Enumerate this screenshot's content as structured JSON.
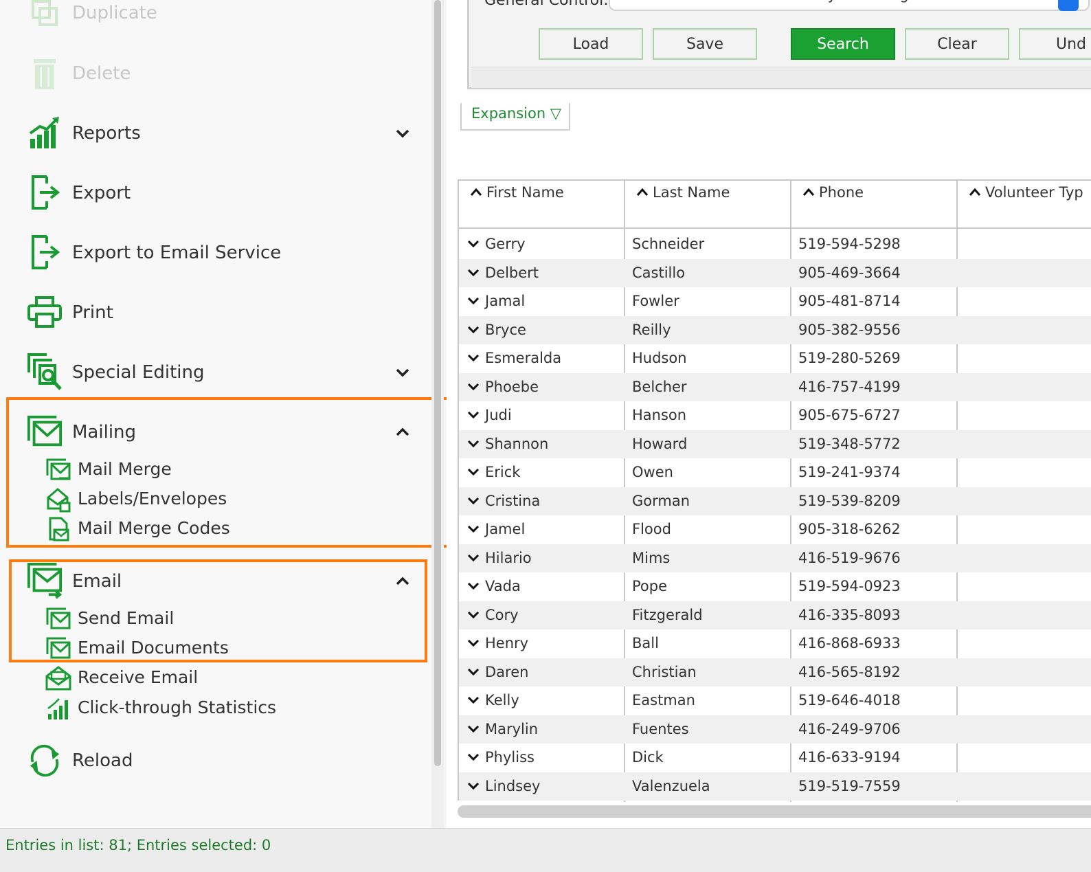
{
  "sidebar": {
    "duplicate": "Duplicate",
    "delete": "Delete",
    "reports": "Reports",
    "export": "Export",
    "export_email_service": "Export to Email Service",
    "print": "Print",
    "special_editing": "Special Editing",
    "mailing": {
      "label": "Mailing",
      "items": [
        "Mail Merge",
        "Labels/Envelopes",
        "Mail Merge Codes"
      ]
    },
    "email": {
      "label": "Email",
      "items": [
        "Send Email",
        "Email Documents",
        "Receive Email",
        "Click-through Statistics"
      ]
    },
    "reload": "Reload",
    "icons": [
      "duplicate-icon",
      "delete-icon",
      "reports-icon",
      "export-icon",
      "export-email-service-icon",
      "print-icon",
      "special-editing-icon",
      "mailing-icon",
      "mail-merge-icon",
      "labels-envelopes-icon",
      "mail-merge-codes-icon",
      "email-icon",
      "send-email-icon",
      "email-documents-icon",
      "receive-email-icon",
      "click-through-statistics-icon",
      "reload-icon"
    ]
  },
  "general_control": {
    "label": "General Control:",
    "value": "Search all records. Show only matching ones.",
    "buttons": {
      "load": "Load",
      "save": "Save",
      "search": "Search",
      "clear": "Clear",
      "undo": "Und"
    }
  },
  "expansion": {
    "label": "Expansion ▽"
  },
  "grid": {
    "columns": [
      "First Name",
      "Last Name",
      "Phone",
      "Volunteer Typ"
    ],
    "rows": [
      [
        "Gerry",
        "Schneider",
        "519-594-5298"
      ],
      [
        "Delbert",
        "Castillo",
        "905-469-3664"
      ],
      [
        "Jamal",
        "Fowler",
        "905-481-8714"
      ],
      [
        "Bryce",
        "Reilly",
        "905-382-9556"
      ],
      [
        "Esmeralda",
        "Hudson",
        "519-280-5269"
      ],
      [
        "Phoebe",
        "Belcher",
        "416-757-4199"
      ],
      [
        "Judi",
        "Hanson",
        "905-675-6727"
      ],
      [
        "Shannon",
        "Howard",
        "519-348-5772"
      ],
      [
        "Erick",
        "Owen",
        "519-241-9374"
      ],
      [
        "Cristina",
        "Gorman",
        "519-539-8209"
      ],
      [
        "Jamel",
        "Flood",
        "905-318-6262"
      ],
      [
        "Hilario",
        "Mims",
        "416-519-9676"
      ],
      [
        "Vada",
        "Pope",
        "519-594-0923"
      ],
      [
        "Cory",
        "Fitzgerald",
        "416-335-8093"
      ],
      [
        "Henry",
        "Ball",
        "416-868-6933"
      ],
      [
        "Daren",
        "Christian",
        "416-565-8192"
      ],
      [
        "Kelly",
        "Eastman",
        "519-646-4018"
      ],
      [
        "Marylin",
        "Fuentes",
        "416-249-9706"
      ],
      [
        "Phyliss",
        "Dick",
        "416-633-9194"
      ],
      [
        "Lindsey",
        "Valenzuela",
        "519-519-7559"
      ]
    ]
  },
  "status": {
    "text": "Entries in list: 81; Entries selected: 0"
  },
  "colors": {
    "accent_green": "#1aa132",
    "icon_green": "#1a9a32",
    "highlight_orange": "#ff7b0f"
  }
}
